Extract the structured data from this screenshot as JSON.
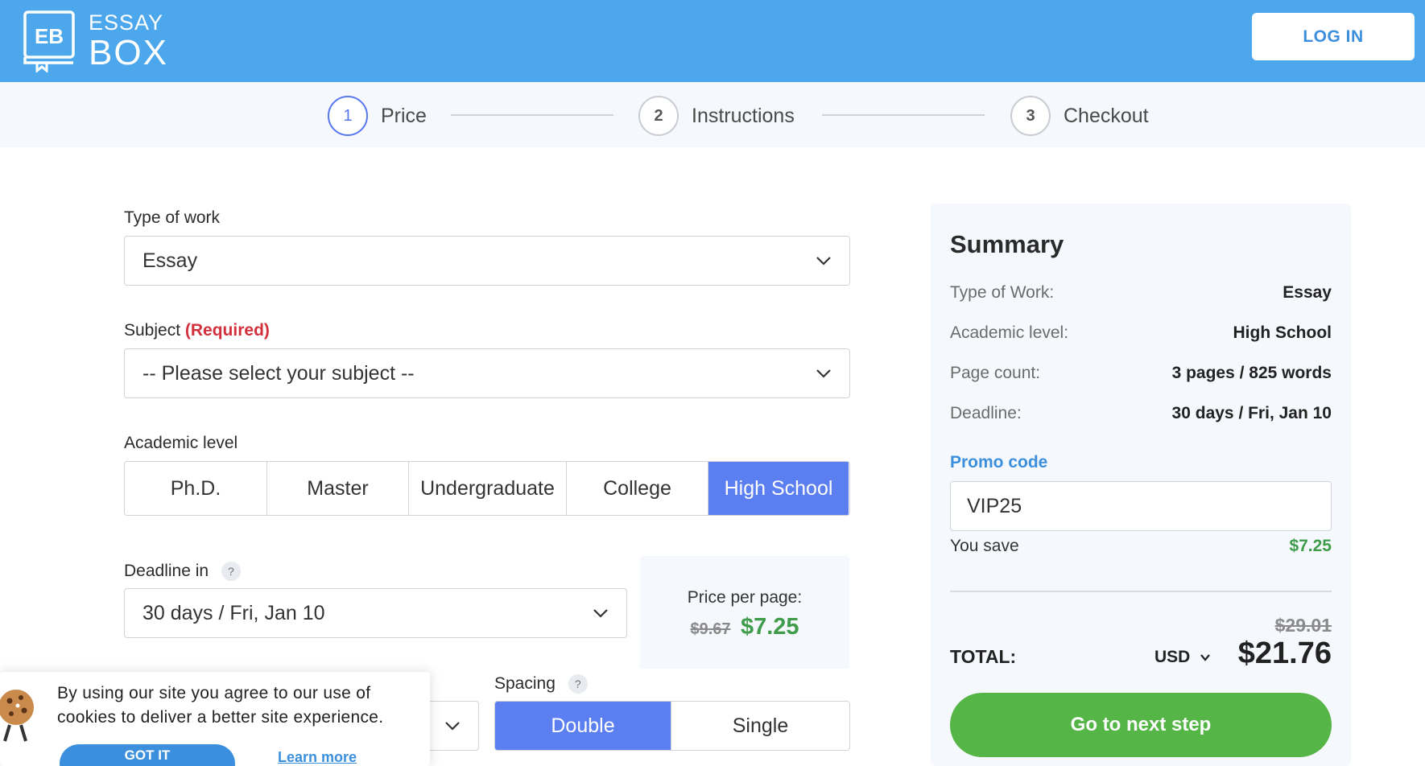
{
  "brand": {
    "line1": "ESSAY",
    "line2": "BOX",
    "mark": "EB"
  },
  "header": {
    "login_label": "LOG IN"
  },
  "stepper": [
    {
      "num": "1",
      "label": "Price"
    },
    {
      "num": "2",
      "label": "Instructions"
    },
    {
      "num": "3",
      "label": "Checkout"
    }
  ],
  "form": {
    "type_of_work": {
      "label": "Type of work",
      "value": "Essay"
    },
    "subject": {
      "label": "Subject",
      "required": "(Required)",
      "value": "-- Please select your subject --"
    },
    "academic_level": {
      "label": "Academic level",
      "options": [
        "Ph.D.",
        "Master",
        "Undergraduate",
        "College",
        "High School"
      ],
      "selected": "High School"
    },
    "deadline": {
      "label": "Deadline in",
      "help": "?",
      "value": "30 days / Fri, Jan 10"
    },
    "price_per_page": {
      "label": "Price per page:",
      "old": "$9.67",
      "new": "$7.25"
    },
    "spacing": {
      "label": "Spacing",
      "help": "?",
      "options": [
        "Double",
        "Single"
      ],
      "selected": "Double"
    }
  },
  "summary": {
    "title": "Summary",
    "rows": [
      {
        "key": "Type of Work:",
        "value": "Essay"
      },
      {
        "key": "Academic level:",
        "value": "High School"
      },
      {
        "key": "Page count:",
        "value": "3 pages / 825 words"
      },
      {
        "key": "Deadline:",
        "value": "30 days / Fri, Jan 10"
      }
    ],
    "promo_label": "Promo code",
    "promo_value": "VIP25",
    "you_save_label": "You save",
    "you_save_value": "$7.25",
    "total_old": "$29.01",
    "total_label": "TOTAL:",
    "currency": "USD",
    "total_value": "$21.76",
    "next_label": "Go to next step"
  },
  "cookie": {
    "text": "By using our site you agree to our use of cookies to deliver a better site experience.",
    "got_it": "GOT IT",
    "learn_more": "Learn more"
  },
  "colors": {
    "header": "#4da7ec",
    "accent": "#5b7ef0",
    "green": "#55b546",
    "required": "#d2303d"
  }
}
